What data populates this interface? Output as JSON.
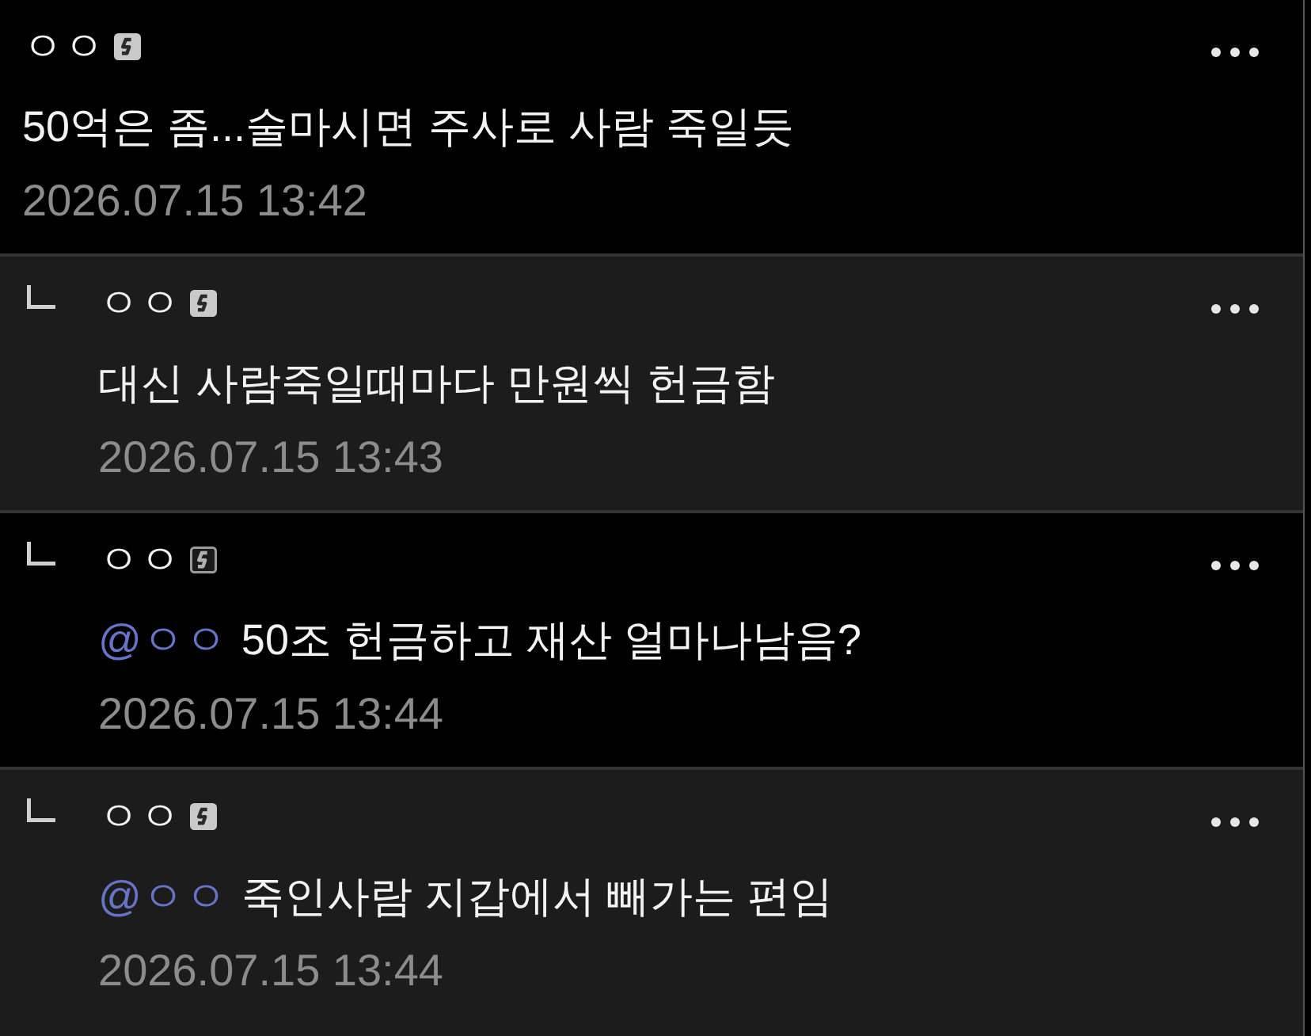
{
  "comments": [
    {
      "kind": "comment",
      "shaded": false,
      "nickname": "ㅇㅇ",
      "badge_outlined": false,
      "text": "50억은 좀...술마시면 주사로 사람 죽일듯",
      "date": "2026.07.15 13:42"
    },
    {
      "kind": "reply",
      "shaded": true,
      "nickname": "ㅇㅇ",
      "badge_outlined": false,
      "text": "대신 사람죽일때마다 만원씩 헌금함",
      "date": "2026.07.15 13:43"
    },
    {
      "kind": "reply",
      "shaded": false,
      "nickname": "ㅇㅇ",
      "badge_outlined": true,
      "mention": "@ㅇㅇ",
      "text": "50조 헌금하고 재산 얼마나남음?",
      "date": "2026.07.15 13:44"
    },
    {
      "kind": "reply",
      "shaded": true,
      "nickname": "ㅇㅇ",
      "badge_outlined": false,
      "mention": "@ㅇㅇ",
      "text": "죽인사람 지갑에서 빼가는 편임",
      "date": "2026.07.15 13:44"
    }
  ]
}
